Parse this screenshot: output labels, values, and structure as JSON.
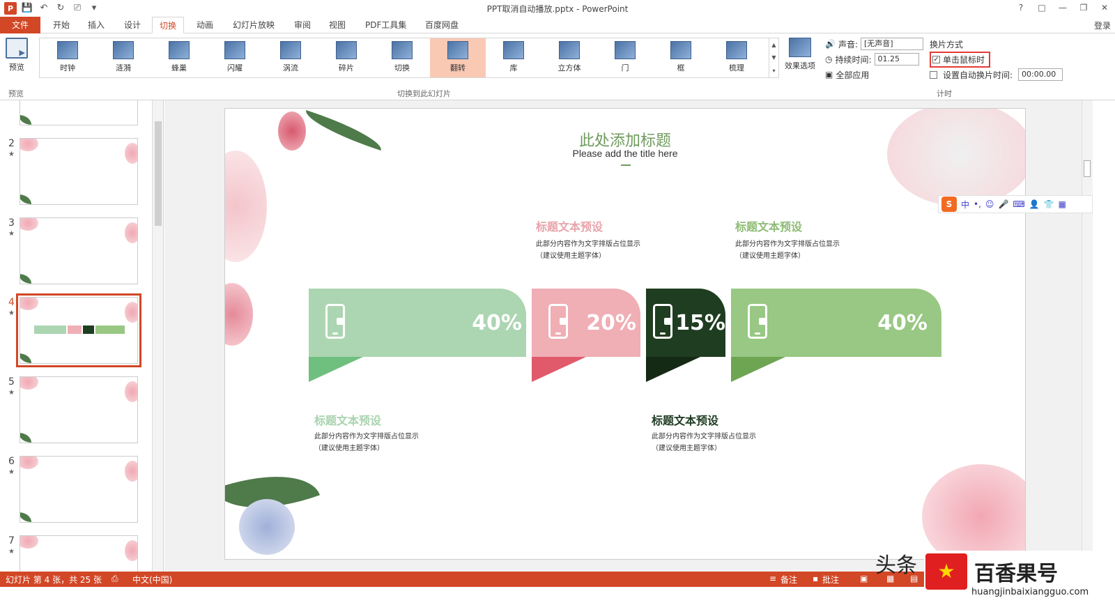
{
  "window": {
    "title": "PPT取消自动播放.pptx - PowerPoint",
    "controls": [
      "?",
      "□",
      "—",
      "❐",
      "✕"
    ]
  },
  "tabs": [
    "文件",
    "开始",
    "插入",
    "设计",
    "切换",
    "动画",
    "幻灯片放映",
    "审阅",
    "视图",
    "PDF工具集",
    "百度网盘"
  ],
  "active_tab": "切换",
  "login": "登录",
  "ribbon": {
    "preview_label": "预览",
    "preview_group": "预览",
    "transitions_group": "切换到此幻灯片",
    "transitions": [
      "时钟",
      "涟漪",
      "蜂巢",
      "闪耀",
      "涡流",
      "碎片",
      "切换",
      "翻转",
      "库",
      "立方体",
      "门",
      "框",
      "梳理"
    ],
    "selected_transition": "翻转",
    "effects_label": "效果选项",
    "sound_label": "声音:",
    "sound_value": "[无声音]",
    "duration_label": "持续时间:",
    "duration_value": "01.25",
    "apply_all": "全部应用",
    "advance_title": "换片方式",
    "on_click_label": "单击鼠标时",
    "on_click_checked": true,
    "auto_after_label": "设置自动换片时间:",
    "auto_after_checked": false,
    "auto_after_value": "00:00.00",
    "timing_group": "计时"
  },
  "thumbnails": [
    {
      "num": "2",
      "star": "★"
    },
    {
      "num": "3",
      "star": "★"
    },
    {
      "num": "4",
      "star": "★"
    },
    {
      "num": "5",
      "star": "★"
    },
    {
      "num": "6",
      "star": "★"
    },
    {
      "num": "7",
      "star": "★"
    }
  ],
  "selected_slide": "4",
  "slide": {
    "title": "此处添加标题",
    "subtitle": "Please add the title here",
    "blocks": [
      {
        "title": "标题文本预设",
        "line1": "此部分内容作为文字排版占位显示",
        "line2": "（建议使用主题字体）",
        "color": "#e8a3ab"
      },
      {
        "title": "标题文本预设",
        "line1": "此部分内容作为文字排版占位显示",
        "line2": "（建议使用主题字体）",
        "color": "#8dbb74"
      },
      {
        "title": "标题文本预设",
        "line1": "此部分内容作为文字排版占位显示",
        "line2": "（建议使用主题字体）",
        "color": "#a8d3ae"
      },
      {
        "title": "标题文本预设",
        "line1": "此部分内容作为文字排版占位显示",
        "line2": "（建议使用主题字体）",
        "color": "#1e3a22"
      }
    ],
    "bands": [
      {
        "pct": "40%",
        "color": "#acd5b2",
        "tail": "#6fbf7e"
      },
      {
        "pct": "20%",
        "color": "#f0aeb5",
        "tail": "#e05a6c"
      },
      {
        "pct": "15%",
        "color": "#1f3d20",
        "tail": "#142a15"
      },
      {
        "pct": "40%",
        "color": "#98c883",
        "tail": "#6ea552"
      }
    ]
  },
  "ime": {
    "logo": "S",
    "items": [
      "中",
      "•,",
      "☺",
      "🎤",
      "⌨",
      "👤",
      "👕",
      "▦"
    ]
  },
  "status": {
    "slide_info": "幻灯片 第 4 张，共 25 张",
    "language": "中文(中国)",
    "notes": "备注",
    "comments": "批注"
  },
  "watermark": {
    "logo": "★",
    "name": "百香果号",
    "url": "huangjinbaixiangguo.com",
    "side": "头条"
  }
}
